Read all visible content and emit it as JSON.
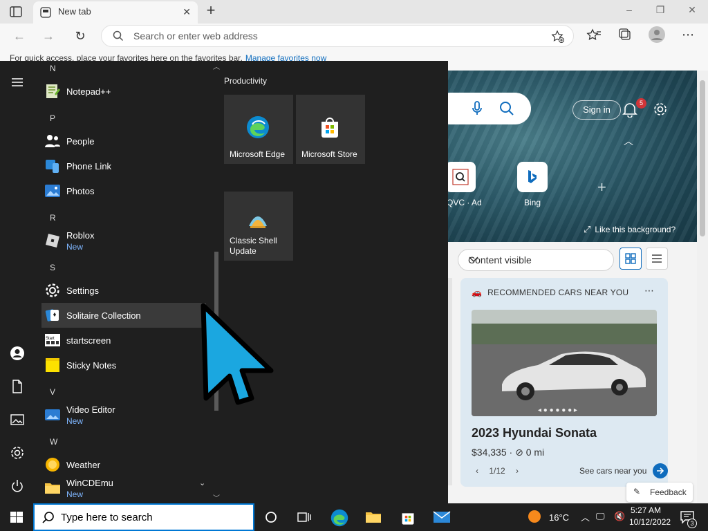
{
  "browser": {
    "tab_title": "New tab",
    "address_placeholder": "Search or enter web address",
    "favbar_text": "For quick access, place your favorites here on the favorites bar.",
    "favbar_link": "Manage favorites now"
  },
  "ntp": {
    "signin": "Sign in",
    "notification_count": "5",
    "quicklinks": [
      {
        "label": "QVC · Ad"
      },
      {
        "label": "Bing"
      }
    ],
    "like_background": "Like this background?",
    "content_select": "Content visible",
    "card": {
      "header": "RECOMMENDED CARS NEAR YOU",
      "title": "2023 Hyundai Sonata",
      "price": "$34,335",
      "mileage": "0 mi",
      "pager": "1/12",
      "cta": "See cars near you"
    },
    "feedback": "Feedback"
  },
  "startmenu": {
    "sections": [
      {
        "letter": "N",
        "apps": [
          {
            "name": "Notepad++",
            "sub": ""
          }
        ]
      },
      {
        "letter": "P",
        "apps": [
          {
            "name": "People",
            "sub": ""
          },
          {
            "name": "Phone Link",
            "sub": ""
          },
          {
            "name": "Photos",
            "sub": ""
          }
        ]
      },
      {
        "letter": "R",
        "apps": [
          {
            "name": "Roblox",
            "sub": "New"
          }
        ]
      },
      {
        "letter": "S",
        "apps": [
          {
            "name": "Settings",
            "sub": ""
          },
          {
            "name": "Solitaire Collection",
            "sub": ""
          },
          {
            "name": "startscreen",
            "sub": ""
          },
          {
            "name": "Sticky Notes",
            "sub": ""
          }
        ]
      },
      {
        "letter": "V",
        "apps": [
          {
            "name": "Video Editor",
            "sub": "New"
          }
        ]
      },
      {
        "letter": "W",
        "apps": [
          {
            "name": "Weather",
            "sub": ""
          },
          {
            "name": "WinCDEmu",
            "sub": "New"
          }
        ]
      }
    ],
    "group_title": "Productivity",
    "tiles": [
      {
        "name": "Microsoft Edge"
      },
      {
        "name": "Microsoft Store"
      },
      {
        "name": "Classic Shell Update"
      }
    ]
  },
  "taskbar": {
    "search_placeholder": "Type here to search",
    "temperature": "16°C",
    "time": "5:27 AM",
    "date": "10/12/2022",
    "notification_count": "3"
  },
  "colors": {
    "accent": "#0078d4",
    "start_bg": "#1f1f1f",
    "new_badge": "#7fb6ff",
    "bell_badge": "#d13438"
  }
}
